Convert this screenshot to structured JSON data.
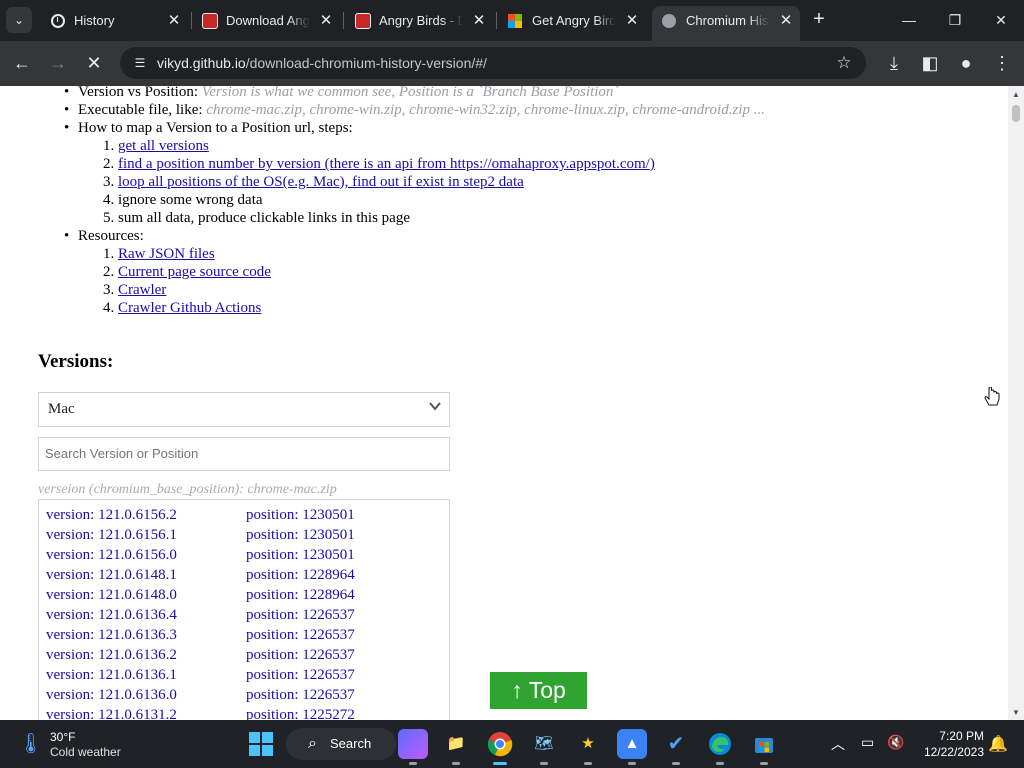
{
  "browser": {
    "tabs": [
      {
        "title": "History",
        "icon": "history-icon"
      },
      {
        "title": "Download Angry",
        "icon": "angry-birds-favicon"
      },
      {
        "title": "Angry Birds - D",
        "icon": "angry-birds-favicon"
      },
      {
        "title": "Get Angry Birds",
        "icon": "microsoft-store-favicon"
      },
      {
        "title": "Chromium Histo",
        "icon": "chromium-favicon",
        "active": true
      }
    ],
    "url_host": "vikyd.github.io",
    "url_path": "/download-chromium-history-version/#/"
  },
  "page": {
    "intro": {
      "version_vs_position_label": "Version vs Position:",
      "version_vs_position_note": "Version is what we common see, Position is a `Branch Base Position`",
      "executable_label": "Executable file, like:",
      "executable_examples": "chrome-mac.zip, chrome-win.zip, chrome-win32.zip, chrome-linux.zip, chrome-android.zip ...",
      "steps_label": "How to map a Version to a Position url, steps:",
      "steps": [
        {
          "text": "get all versions",
          "link": true
        },
        {
          "text": "find a position number by version (there is an api from https://omahaproxy.appspot.com/)",
          "link": true
        },
        {
          "text": "loop all positions of the OS(e.g. Mac), find out if exist in step2 data",
          "link": true
        },
        {
          "text": "ignore some wrong data",
          "link": false
        },
        {
          "text": "sum all data, produce clickable links in this page",
          "link": false
        }
      ],
      "resources_label": "Resources:",
      "resources": [
        "Raw JSON files",
        "Current page source code",
        "Crawler",
        "Crawler Github Actions"
      ]
    },
    "versions_heading": "Versions:",
    "os_select": "Mac",
    "search_placeholder": "Search Version or Position",
    "list_hint": "verseion (chromium_base_position): chrome-mac.zip",
    "versions": [
      {
        "version": "version: 121.0.6156.2",
        "position": "position: 1230501"
      },
      {
        "version": "version: 121.0.6156.1",
        "position": "position: 1230501"
      },
      {
        "version": "version: 121.0.6156.0",
        "position": "position: 1230501"
      },
      {
        "version": "version: 121.0.6148.1",
        "position": "position: 1228964"
      },
      {
        "version": "version: 121.0.6148.0",
        "position": "position: 1228964"
      },
      {
        "version": "version: 121.0.6136.4",
        "position": "position: 1226537"
      },
      {
        "version": "version: 121.0.6136.3",
        "position": "position: 1226537"
      },
      {
        "version": "version: 121.0.6136.2",
        "position": "position: 1226537"
      },
      {
        "version": "version: 121.0.6136.1",
        "position": "position: 1226537"
      },
      {
        "version": "version: 121.0.6136.0",
        "position": "position: 1226537"
      },
      {
        "version": "version: 121.0.6131.2",
        "position": "position: 1225272"
      }
    ],
    "top_button": "↑ Top"
  },
  "taskbar": {
    "weather_temp": "30°F",
    "weather_condition": "Cold weather",
    "search_label": "Search",
    "time": "7:20 PM",
    "date": "12/22/2023"
  }
}
